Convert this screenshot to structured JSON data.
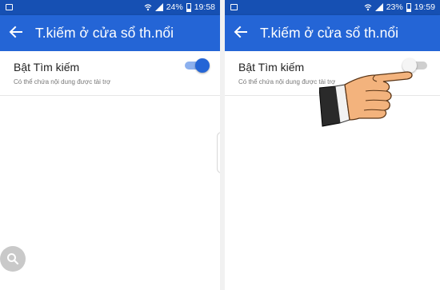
{
  "screens": [
    {
      "status": {
        "battery": "24%",
        "time": "19:58"
      },
      "title": "T.kiếm ở cửa sổ th.nổi",
      "setting": {
        "label": "Bật Tìm kiếm",
        "sub": "Có thể chứa nội dung được tài trợ",
        "enabled": true
      }
    },
    {
      "status": {
        "battery": "23%",
        "time": "19:59"
      },
      "title": "T.kiếm ở cửa sổ th.nổi",
      "setting": {
        "label": "Bật Tìm kiếm",
        "sub": "Có thể chứa nội dung được tài trợ",
        "enabled": false
      }
    }
  ],
  "colors": {
    "statusbar": "#1650b3",
    "appbar": "#2465d6",
    "toggle_on": "#2465d6",
    "toggle_off": "#f5f5f5"
  },
  "icons": [
    "image-icon",
    "wifi-icon",
    "signal-icon",
    "battery-icon",
    "back-arrow-icon",
    "search-icon",
    "pointing-hand-icon"
  ]
}
